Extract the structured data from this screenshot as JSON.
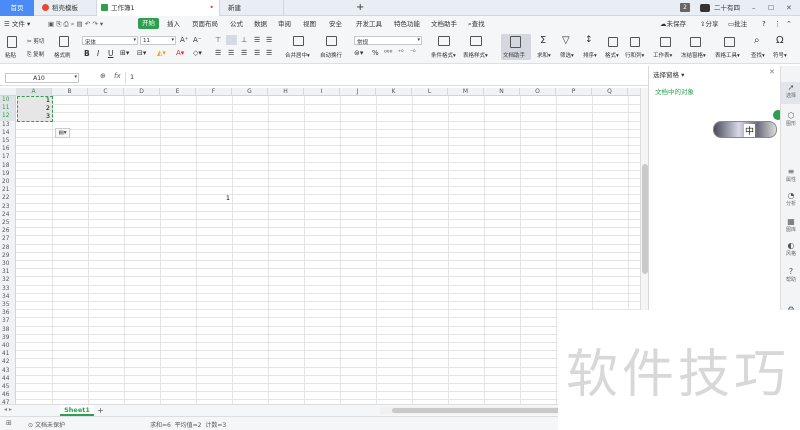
{
  "tabs": {
    "home": "首页",
    "template": "稻壳模板",
    "workbook": "工作簿1",
    "new": "新建",
    "plus": "+",
    "badge": "2",
    "user": "二十有四"
  },
  "menu": {
    "file": "文件",
    "start": "开始",
    "insert": "插入",
    "page_layout": "页面布局",
    "formula": "公式",
    "data": "数据",
    "review": "审阅",
    "view": "视图",
    "security": "安全",
    "dev_tools": "开发工具",
    "special": "特色功能",
    "doc_helper": "文档助手",
    "find": "查找",
    "unsaved": "未保存",
    "share": "分享",
    "comment": "批注"
  },
  "ribbon": {
    "cut": "剪切",
    "copy": "复制",
    "paste": "粘贴",
    "format_painter": "格式刷",
    "font": "宋体",
    "font_size": "11",
    "merge_center": "合并居中",
    "auto_wrap": "自动换行",
    "number_format": "常规",
    "cond_format": "条件格式",
    "table_style": "表格样式",
    "doc_helper": "文档助手",
    "sum": "求和",
    "filter": "筛选",
    "sort": "排序",
    "format": "格式",
    "rows_cols": "行和列",
    "worksheet": "工作表",
    "freeze": "冻结窗格",
    "table_tools": "表格工具",
    "find": "查找",
    "symbol": "符号"
  },
  "formula": {
    "cell_ref": "A10",
    "fx": "fx",
    "value": "1"
  },
  "grid": {
    "columns": [
      "A",
      "B",
      "C",
      "D",
      "E",
      "F",
      "G",
      "H",
      "I",
      "J",
      "K",
      "L",
      "M",
      "N",
      "O",
      "P",
      "Q"
    ],
    "row_start": 10,
    "row_count": 38,
    "cells": [
      {
        "row": 10,
        "col": "A",
        "value": "1"
      },
      {
        "row": 11,
        "col": "A",
        "value": "2"
      },
      {
        "row": 12,
        "col": "A",
        "value": "3"
      },
      {
        "row": 22,
        "col": "F",
        "value": "1"
      }
    ]
  },
  "panel": {
    "title": "选择窗格",
    "subtitle": "文档中的对象",
    "ime": "中"
  },
  "sidebar": [
    {
      "icon": "cursor-icon",
      "label": "选择"
    },
    {
      "icon": "shapes-icon",
      "label": "图形"
    },
    {
      "icon": "property-icon",
      "label": "属性"
    },
    {
      "icon": "analysis-icon",
      "label": "分析"
    },
    {
      "icon": "gallery-icon",
      "label": "图库"
    },
    {
      "icon": "style-icon",
      "label": "风格"
    },
    {
      "icon": "help-icon",
      "label": "帮助"
    },
    {
      "icon": "settings-icon",
      "label": "设置"
    }
  ],
  "sheets": {
    "active": "Sheet1",
    "add": "+"
  },
  "status": {
    "protect": "文档未保护",
    "stats": "求和=6  平均值=2  计数=3"
  },
  "watermark": "软件技巧",
  "colors": {
    "accent_green": "#2e9e4f",
    "home_tab": "#4a8bf5",
    "selection": "#e6e6e6"
  }
}
